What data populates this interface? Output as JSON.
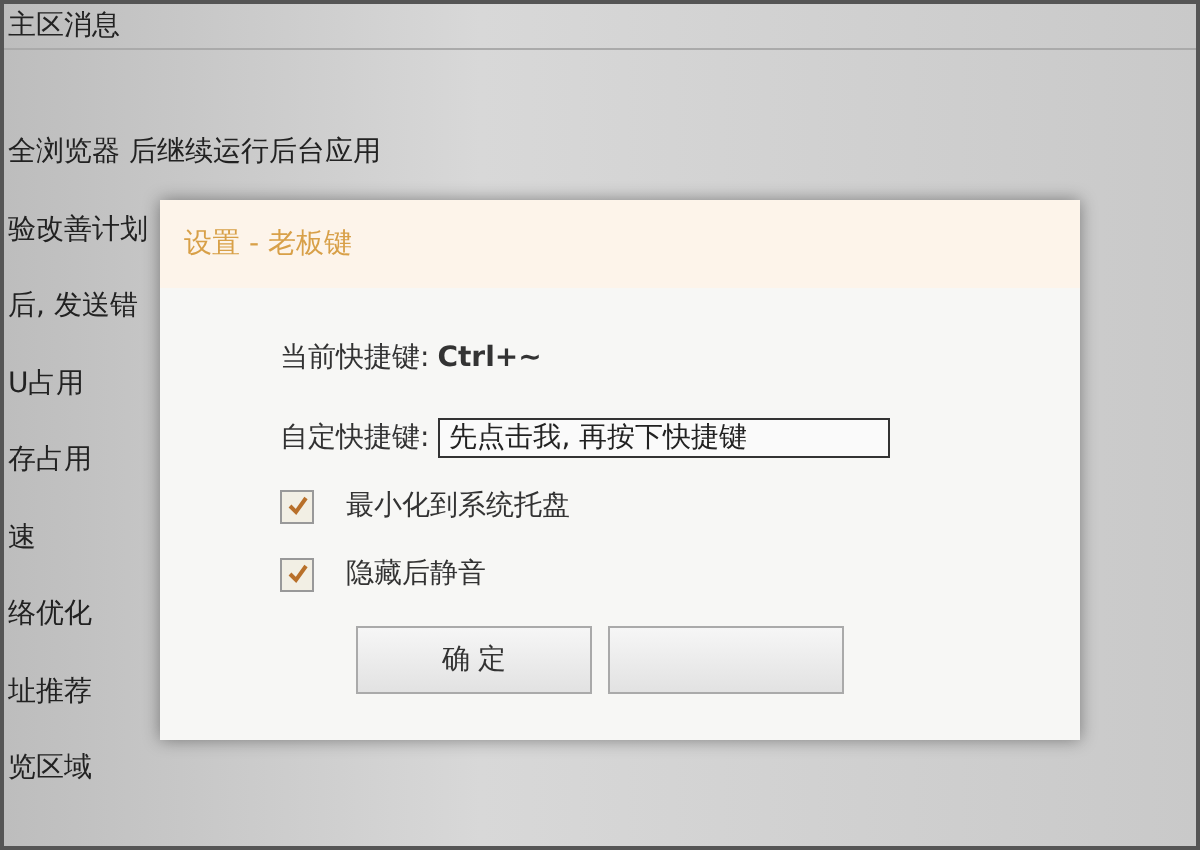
{
  "background_settings": [
    "主区消息",
    "全浏览器 后继续运行后台应用",
    "验改善计划",
    "后, 发送错",
    "U占用",
    "存占用",
    "速",
    "络优化",
    "址推荐",
    "览区域"
  ],
  "dialog": {
    "title": "设置 - 老板键",
    "current_label": "当前快捷键:",
    "current_value": "Ctrl+~",
    "custom_label": "自定快捷键:",
    "custom_field": {
      "value": "先点击我, 再按下快捷键"
    },
    "checkboxes": [
      {
        "label": "最小化到系统托盘",
        "checked": true
      },
      {
        "label": "隐藏后静音",
        "checked": true
      }
    ],
    "buttons": [
      "确 定"
    ]
  }
}
